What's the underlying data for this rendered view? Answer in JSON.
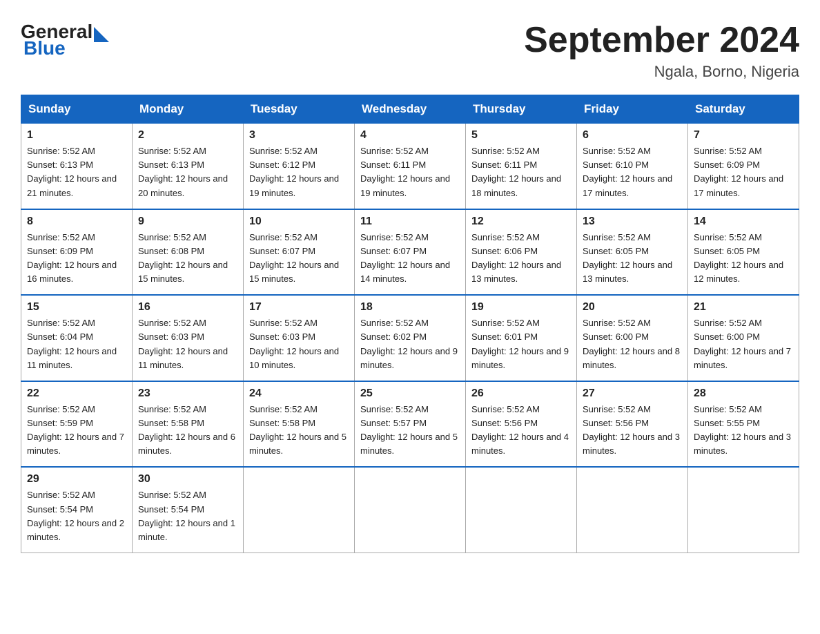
{
  "header": {
    "logo_general": "General",
    "logo_blue": "Blue",
    "title": "September 2024",
    "subtitle": "Ngala, Borno, Nigeria"
  },
  "days_of_week": [
    "Sunday",
    "Monday",
    "Tuesday",
    "Wednesday",
    "Thursday",
    "Friday",
    "Saturday"
  ],
  "weeks": [
    [
      {
        "day": "1",
        "sunrise": "5:52 AM",
        "sunset": "6:13 PM",
        "daylight": "12 hours and 21 minutes."
      },
      {
        "day": "2",
        "sunrise": "5:52 AM",
        "sunset": "6:13 PM",
        "daylight": "12 hours and 20 minutes."
      },
      {
        "day": "3",
        "sunrise": "5:52 AM",
        "sunset": "6:12 PM",
        "daylight": "12 hours and 19 minutes."
      },
      {
        "day": "4",
        "sunrise": "5:52 AM",
        "sunset": "6:11 PM",
        "daylight": "12 hours and 19 minutes."
      },
      {
        "day": "5",
        "sunrise": "5:52 AM",
        "sunset": "6:11 PM",
        "daylight": "12 hours and 18 minutes."
      },
      {
        "day": "6",
        "sunrise": "5:52 AM",
        "sunset": "6:10 PM",
        "daylight": "12 hours and 17 minutes."
      },
      {
        "day": "7",
        "sunrise": "5:52 AM",
        "sunset": "6:09 PM",
        "daylight": "12 hours and 17 minutes."
      }
    ],
    [
      {
        "day": "8",
        "sunrise": "5:52 AM",
        "sunset": "6:09 PM",
        "daylight": "12 hours and 16 minutes."
      },
      {
        "day": "9",
        "sunrise": "5:52 AM",
        "sunset": "6:08 PM",
        "daylight": "12 hours and 15 minutes."
      },
      {
        "day": "10",
        "sunrise": "5:52 AM",
        "sunset": "6:07 PM",
        "daylight": "12 hours and 15 minutes."
      },
      {
        "day": "11",
        "sunrise": "5:52 AM",
        "sunset": "6:07 PM",
        "daylight": "12 hours and 14 minutes."
      },
      {
        "day": "12",
        "sunrise": "5:52 AM",
        "sunset": "6:06 PM",
        "daylight": "12 hours and 13 minutes."
      },
      {
        "day": "13",
        "sunrise": "5:52 AM",
        "sunset": "6:05 PM",
        "daylight": "12 hours and 13 minutes."
      },
      {
        "day": "14",
        "sunrise": "5:52 AM",
        "sunset": "6:05 PM",
        "daylight": "12 hours and 12 minutes."
      }
    ],
    [
      {
        "day": "15",
        "sunrise": "5:52 AM",
        "sunset": "6:04 PM",
        "daylight": "12 hours and 11 minutes."
      },
      {
        "day": "16",
        "sunrise": "5:52 AM",
        "sunset": "6:03 PM",
        "daylight": "12 hours and 11 minutes."
      },
      {
        "day": "17",
        "sunrise": "5:52 AM",
        "sunset": "6:03 PM",
        "daylight": "12 hours and 10 minutes."
      },
      {
        "day": "18",
        "sunrise": "5:52 AM",
        "sunset": "6:02 PM",
        "daylight": "12 hours and 9 minutes."
      },
      {
        "day": "19",
        "sunrise": "5:52 AM",
        "sunset": "6:01 PM",
        "daylight": "12 hours and 9 minutes."
      },
      {
        "day": "20",
        "sunrise": "5:52 AM",
        "sunset": "6:00 PM",
        "daylight": "12 hours and 8 minutes."
      },
      {
        "day": "21",
        "sunrise": "5:52 AM",
        "sunset": "6:00 PM",
        "daylight": "12 hours and 7 minutes."
      }
    ],
    [
      {
        "day": "22",
        "sunrise": "5:52 AM",
        "sunset": "5:59 PM",
        "daylight": "12 hours and 7 minutes."
      },
      {
        "day": "23",
        "sunrise": "5:52 AM",
        "sunset": "5:58 PM",
        "daylight": "12 hours and 6 minutes."
      },
      {
        "day": "24",
        "sunrise": "5:52 AM",
        "sunset": "5:58 PM",
        "daylight": "12 hours and 5 minutes."
      },
      {
        "day": "25",
        "sunrise": "5:52 AM",
        "sunset": "5:57 PM",
        "daylight": "12 hours and 5 minutes."
      },
      {
        "day": "26",
        "sunrise": "5:52 AM",
        "sunset": "5:56 PM",
        "daylight": "12 hours and 4 minutes."
      },
      {
        "day": "27",
        "sunrise": "5:52 AM",
        "sunset": "5:56 PM",
        "daylight": "12 hours and 3 minutes."
      },
      {
        "day": "28",
        "sunrise": "5:52 AM",
        "sunset": "5:55 PM",
        "daylight": "12 hours and 3 minutes."
      }
    ],
    [
      {
        "day": "29",
        "sunrise": "5:52 AM",
        "sunset": "5:54 PM",
        "daylight": "12 hours and 2 minutes."
      },
      {
        "day": "30",
        "sunrise": "5:52 AM",
        "sunset": "5:54 PM",
        "daylight": "12 hours and 1 minute."
      },
      null,
      null,
      null,
      null,
      null
    ]
  ],
  "labels": {
    "sunrise": "Sunrise:",
    "sunset": "Sunset:",
    "daylight": "Daylight:"
  }
}
